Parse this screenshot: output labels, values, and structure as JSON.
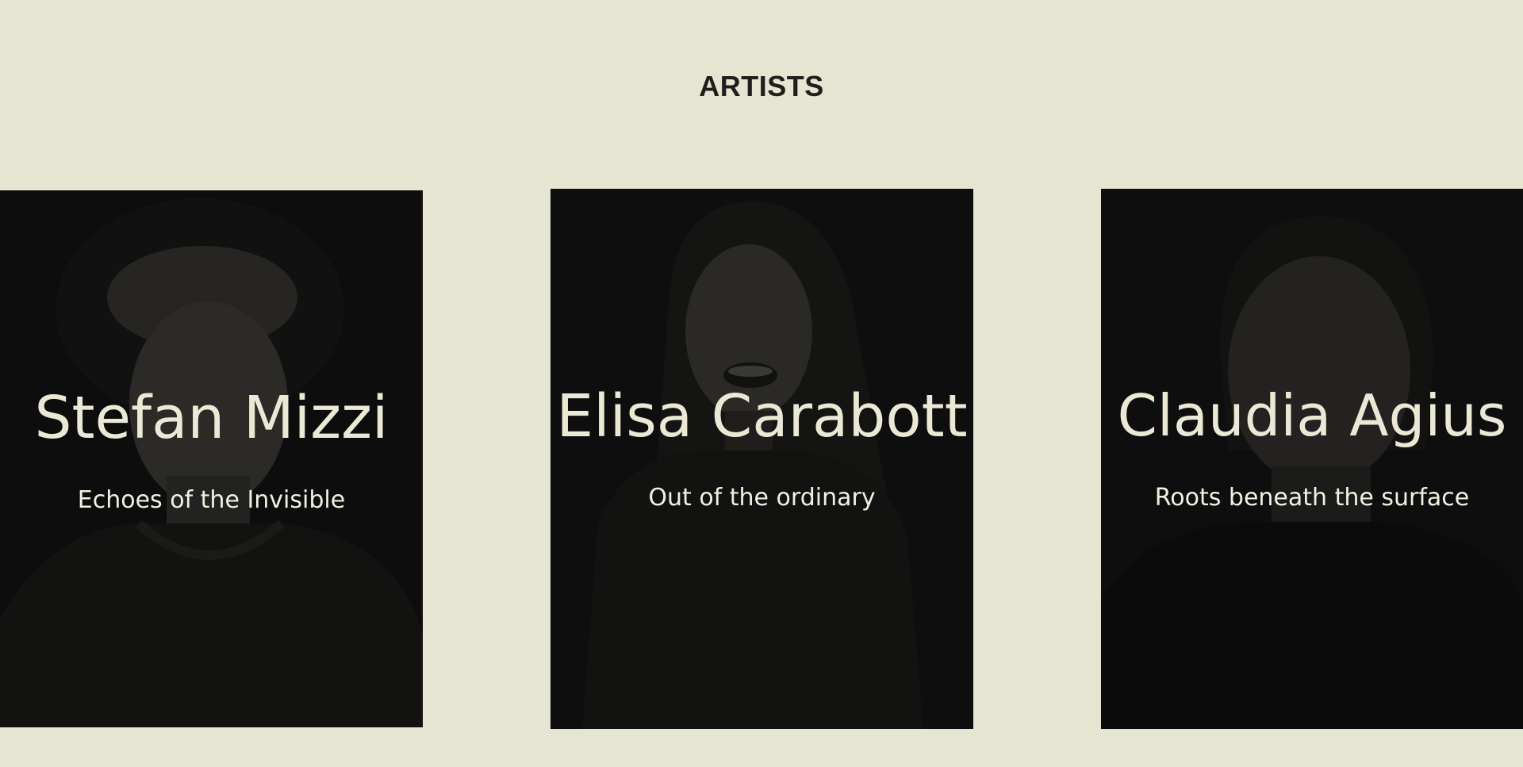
{
  "section": {
    "title": "ARTISTS"
  },
  "artists": [
    {
      "name": "Stefan Mizzi",
      "subtitle": "Echoes of the Invisible",
      "icon": "portrait-photo-icon"
    },
    {
      "name": "Elisa Carabott",
      "subtitle": "Out of the ordinary",
      "icon": "portrait-photo-icon"
    },
    {
      "name": "Claudia Agius",
      "subtitle": "Roots beneath the surface",
      "icon": "portrait-photo-icon"
    }
  ],
  "colors": {
    "background": "#e6e5d1",
    "card": "#0e0e0e",
    "card_text": "#ebe9d6",
    "title_text": "#1f1e1c"
  }
}
